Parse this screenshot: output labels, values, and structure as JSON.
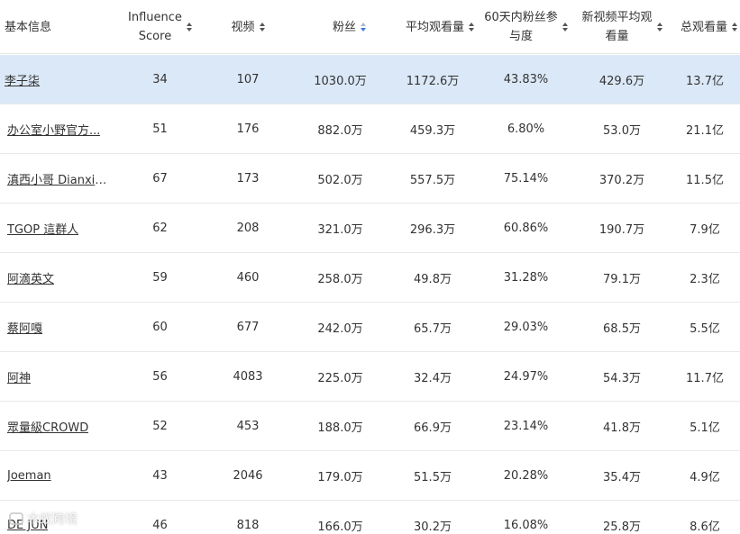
{
  "columns": [
    {
      "label": "基本信息"
    },
    {
      "label": "Influence Score"
    },
    {
      "label": "视频"
    },
    {
      "label": "粉丝"
    },
    {
      "label": "平均观看量"
    },
    {
      "label": "60天内粉丝参与度"
    },
    {
      "label": "新视频平均观看量"
    },
    {
      "label": "总观看量"
    }
  ],
  "header": {
    "col0": "基本信息",
    "col1_line1": "Influence",
    "col1_line2": "Score",
    "col2": "视频",
    "col3": "粉丝",
    "col4": "平均观看量",
    "col5_line1": "60天内粉丝参",
    "col5_line2": "与度",
    "col6_line1": "新视频平均观",
    "col6_line2": "看量",
    "col7": "总观看量"
  },
  "sort": {
    "active_column": "粉丝",
    "direction": "descending",
    "accent": "#3b7ae0"
  },
  "selected_row_color": "#dbe8f7",
  "rows": [
    {
      "name": "李子柒",
      "score": "34",
      "videos": "107",
      "fans": "1030.0万",
      "avg_views": "1172.6万",
      "engagement": "43.83%",
      "new_avg_views": "429.6万",
      "total_views": "13.7亿",
      "selected": true
    },
    {
      "name": "办公室小野官方...",
      "score": "51",
      "videos": "176",
      "fans": "882.0万",
      "avg_views": "459.3万",
      "engagement": "6.80%",
      "new_avg_views": "53.0万",
      "total_views": "21.1亿"
    },
    {
      "name": "滇西小哥 Dianxi ...",
      "score": "67",
      "videos": "173",
      "fans": "502.0万",
      "avg_views": "557.5万",
      "engagement": "75.14%",
      "new_avg_views": "370.2万",
      "total_views": "11.5亿"
    },
    {
      "name": "TGOP 這群人",
      "score": "62",
      "videos": "208",
      "fans": "321.0万",
      "avg_views": "296.3万",
      "engagement": "60.86%",
      "new_avg_views": "190.7万",
      "total_views": "7.9亿"
    },
    {
      "name": "阿滴英文",
      "score": "59",
      "videos": "460",
      "fans": "258.0万",
      "avg_views": "49.8万",
      "engagement": "31.28%",
      "new_avg_views": "79.1万",
      "total_views": "2.3亿"
    },
    {
      "name": "蔡阿嘎",
      "score": "60",
      "videos": "677",
      "fans": "242.0万",
      "avg_views": "65.7万",
      "engagement": "29.03%",
      "new_avg_views": "68.5万",
      "total_views": "5.5亿"
    },
    {
      "name": "阿神",
      "score": "56",
      "videos": "4083",
      "fans": "225.0万",
      "avg_views": "32.4万",
      "engagement": "24.97%",
      "new_avg_views": "54.3万",
      "total_views": "11.7亿"
    },
    {
      "name": "眾量級CROWD",
      "score": "52",
      "videos": "453",
      "fans": "188.0万",
      "avg_views": "66.9万",
      "engagement": "23.14%",
      "new_avg_views": "41.8万",
      "total_views": "5.1亿"
    },
    {
      "name": "Joeman",
      "score": "43",
      "videos": "2046",
      "fans": "179.0万",
      "avg_views": "51.5万",
      "engagement": "20.28%",
      "new_avg_views": "35.4万",
      "total_views": "4.9亿"
    },
    {
      "name": "DE JUN",
      "score": "46",
      "videos": "818",
      "fans": "166.0万",
      "avg_views": "30.2万",
      "engagement": "16.08%",
      "new_avg_views": "25.8万",
      "total_views": "8.6亿"
    }
  ],
  "watermark": {
    "text": "木蚁跨境",
    "icon": "watermark-logo-icon"
  }
}
